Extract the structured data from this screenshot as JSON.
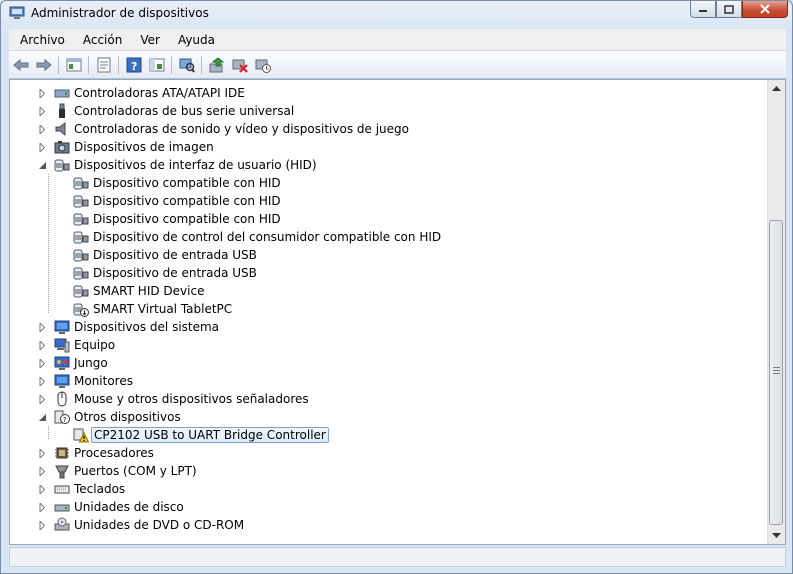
{
  "window": {
    "title": "Administrador de dispositivos",
    "title_icon": "device-manager-icon",
    "accent": "#c13d22"
  },
  "menu": [
    "Archivo",
    "Acción",
    "Ver",
    "Ayuda"
  ],
  "toolbar": [
    "back-icon",
    "forward-icon",
    "up-icon",
    "properties-icon",
    "help-icon",
    "show-hide-console-icon",
    "scan-hardware-icon",
    "update-driver-icon",
    "uninstall-icon",
    "disable-icon"
  ],
  "tree": [
    {
      "label": "Controladoras ATA/ATAPI IDE",
      "icon": "ide-controller-icon",
      "expanded": false
    },
    {
      "label": "Controladoras de bus serie universal",
      "icon": "usb-controller-icon",
      "expanded": false
    },
    {
      "label": "Controladoras de sonido y vídeo y dispositivos de juego",
      "icon": "speaker-icon",
      "expanded": false
    },
    {
      "label": "Dispositivos de imagen",
      "icon": "camera-icon",
      "expanded": false
    },
    {
      "label": "Dispositivos de interfaz de usuario (HID)",
      "icon": "hid-icon",
      "expanded": true,
      "children": [
        {
          "label": "Dispositivo compatible con HID",
          "icon": "hid-icon"
        },
        {
          "label": "Dispositivo compatible con HID",
          "icon": "hid-icon"
        },
        {
          "label": "Dispositivo compatible con HID",
          "icon": "hid-icon"
        },
        {
          "label": "Dispositivo de control del consumidor compatible con HID",
          "icon": "hid-icon"
        },
        {
          "label": "Dispositivo de entrada USB",
          "icon": "hid-icon"
        },
        {
          "label": "Dispositivo de entrada USB",
          "icon": "hid-icon"
        },
        {
          "label": "SMART HID Device",
          "icon": "hid-icon"
        },
        {
          "label": "SMART Virtual TabletPC",
          "icon": "hid-disabled-icon"
        }
      ]
    },
    {
      "label": "Dispositivos del sistema",
      "icon": "monitor-icon",
      "expanded": false
    },
    {
      "label": "Equipo",
      "icon": "computer-icon",
      "expanded": false
    },
    {
      "label": "Jungo",
      "icon": "jungo-icon",
      "expanded": false
    },
    {
      "label": "Monitores",
      "icon": "monitor-icon",
      "expanded": false
    },
    {
      "label": "Mouse y otros dispositivos señaladores",
      "icon": "mouse-icon",
      "expanded": false
    },
    {
      "label": "Otros dispositivos",
      "icon": "unknown-device-icon",
      "expanded": true,
      "children": [
        {
          "label": "CP2102 USB to UART Bridge Controller",
          "icon": "warning-device-icon",
          "selected": true
        }
      ]
    },
    {
      "label": "Procesadores",
      "icon": "processor-icon",
      "expanded": false
    },
    {
      "label": "Puertos (COM y LPT)",
      "icon": "port-icon",
      "expanded": false
    },
    {
      "label": "Teclados",
      "icon": "keyboard-icon",
      "expanded": false
    },
    {
      "label": "Unidades de disco",
      "icon": "disk-drive-icon",
      "expanded": false
    },
    {
      "label": "Unidades de DVD o CD-ROM",
      "icon": "dvd-drive-icon",
      "expanded": false
    }
  ]
}
